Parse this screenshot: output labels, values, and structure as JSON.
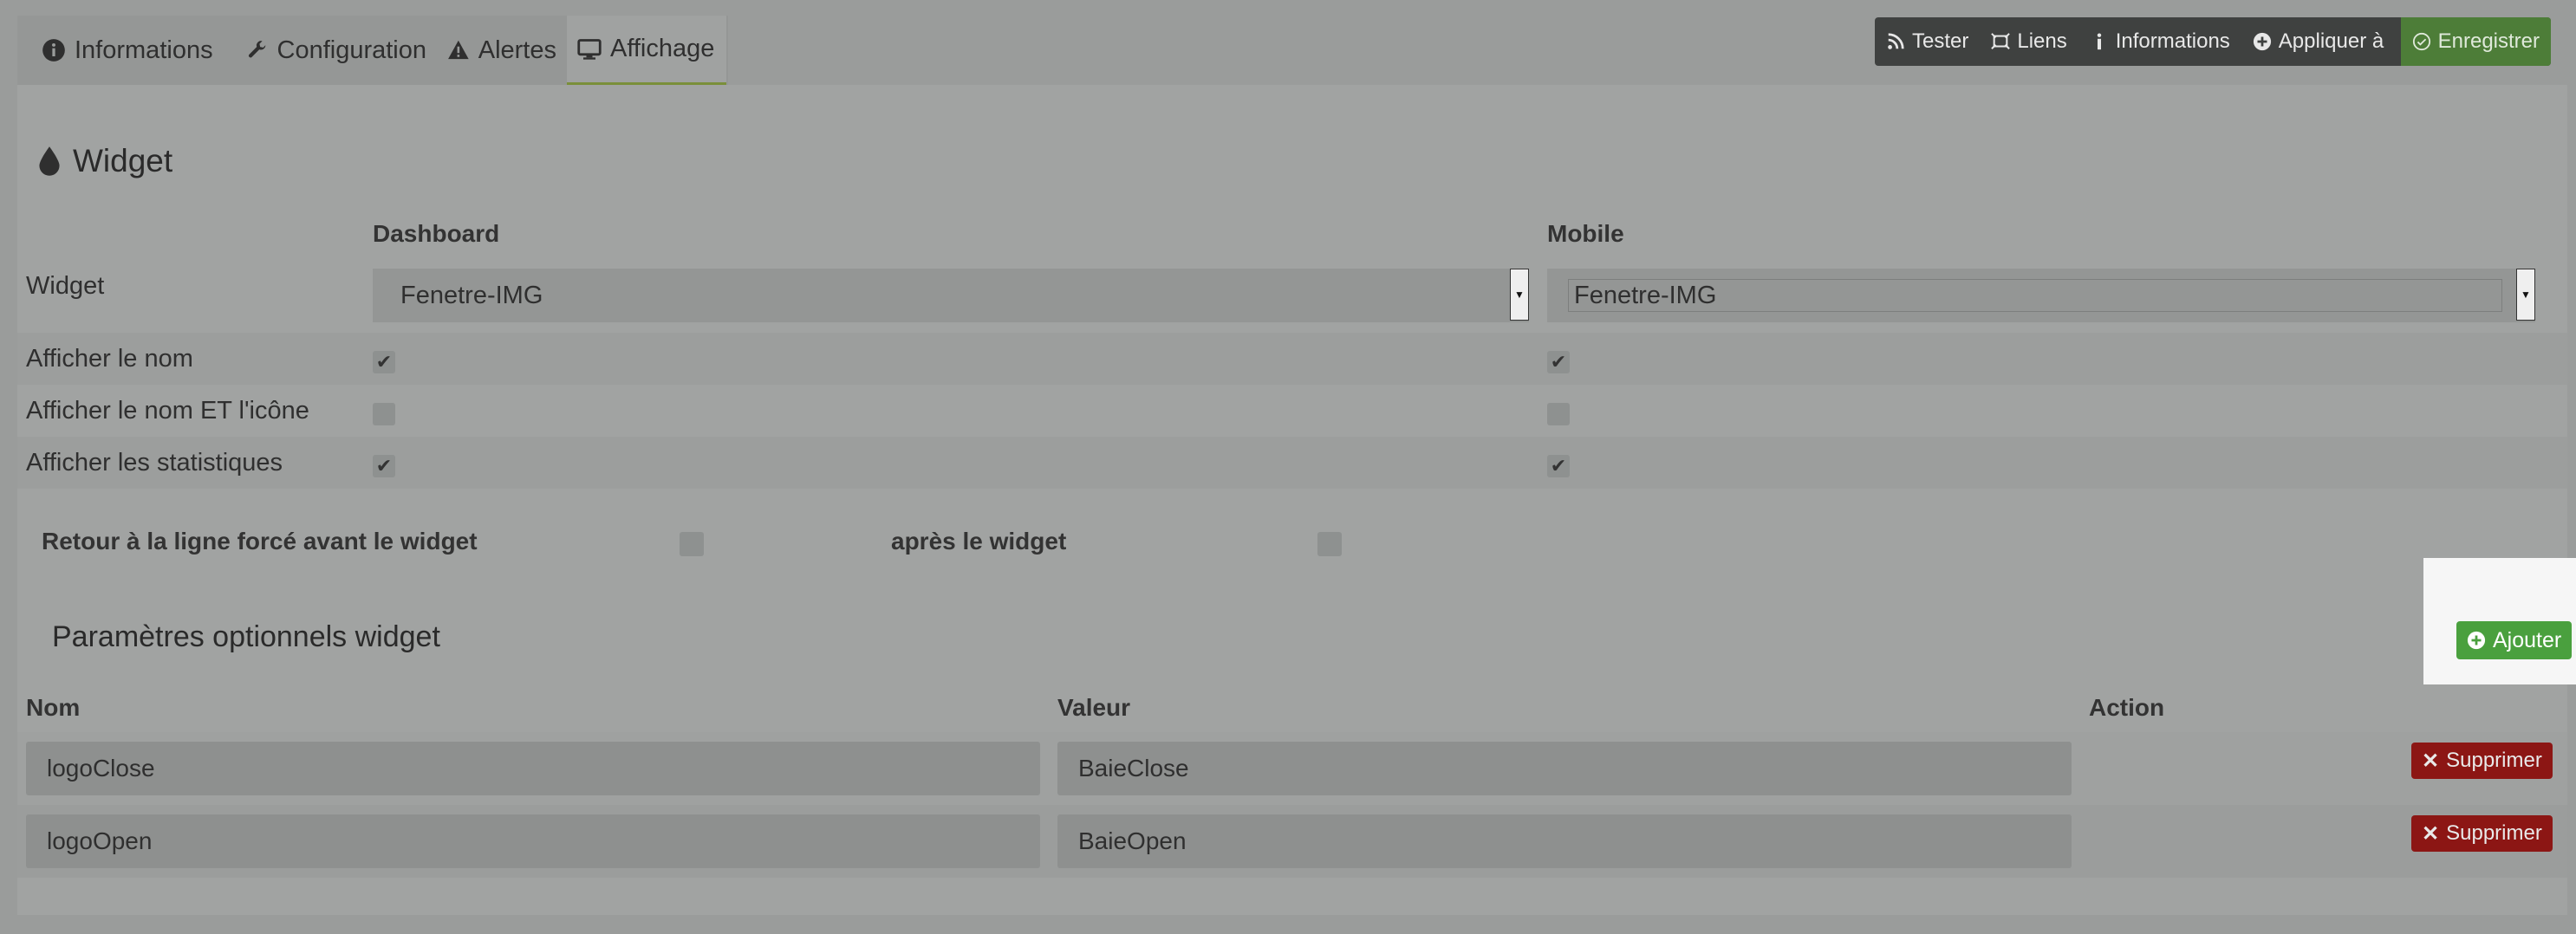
{
  "tabs": [
    {
      "label": "Informations",
      "icon": "info-circle-icon"
    },
    {
      "label": "Configuration",
      "icon": "wrench-icon"
    },
    {
      "label": "Alertes",
      "icon": "warning-icon"
    },
    {
      "label": "Affichage",
      "icon": "monitor-icon",
      "active": true
    }
  ],
  "toolbar": {
    "tester": "Tester",
    "liens": "Liens",
    "informations": "Informations",
    "appliquer": "Appliquer à",
    "enregistrer": "Enregistrer"
  },
  "widget_section": {
    "title": "Widget",
    "col_dashboard": "Dashboard",
    "col_mobile": "Mobile",
    "rows": {
      "widget": "Widget",
      "show_name": "Afficher le nom",
      "show_name_icon": "Afficher le nom ET l'icône",
      "show_stats": "Afficher les statistiques"
    },
    "dashboard_widget_value": "Fenetre-IMG",
    "mobile_widget_value": "Fenetre-IMG",
    "dashboard_checks": [
      true,
      false,
      true
    ],
    "mobile_checks": [
      true,
      false,
      true
    ],
    "line_break_before": "Retour à la ligne forcé avant le widget",
    "line_break_after": "après le widget"
  },
  "optional_params": {
    "title": "Paramètres optionnels widget",
    "add_label": "Ajouter",
    "col_name": "Nom",
    "col_value": "Valeur",
    "col_action": "Action",
    "delete_label": "Supprimer",
    "rows": [
      {
        "name": "logoClose",
        "value": "BaieClose"
      },
      {
        "name": "logoOpen",
        "value": "BaieOpen"
      }
    ]
  },
  "colors": {
    "overlay_bg": "#9a9c9b",
    "save_green": "#4d7d38",
    "add_green": "#4aa03e",
    "delete_red": "#8c1614",
    "active_tab_underline": "#7a8f3a"
  }
}
